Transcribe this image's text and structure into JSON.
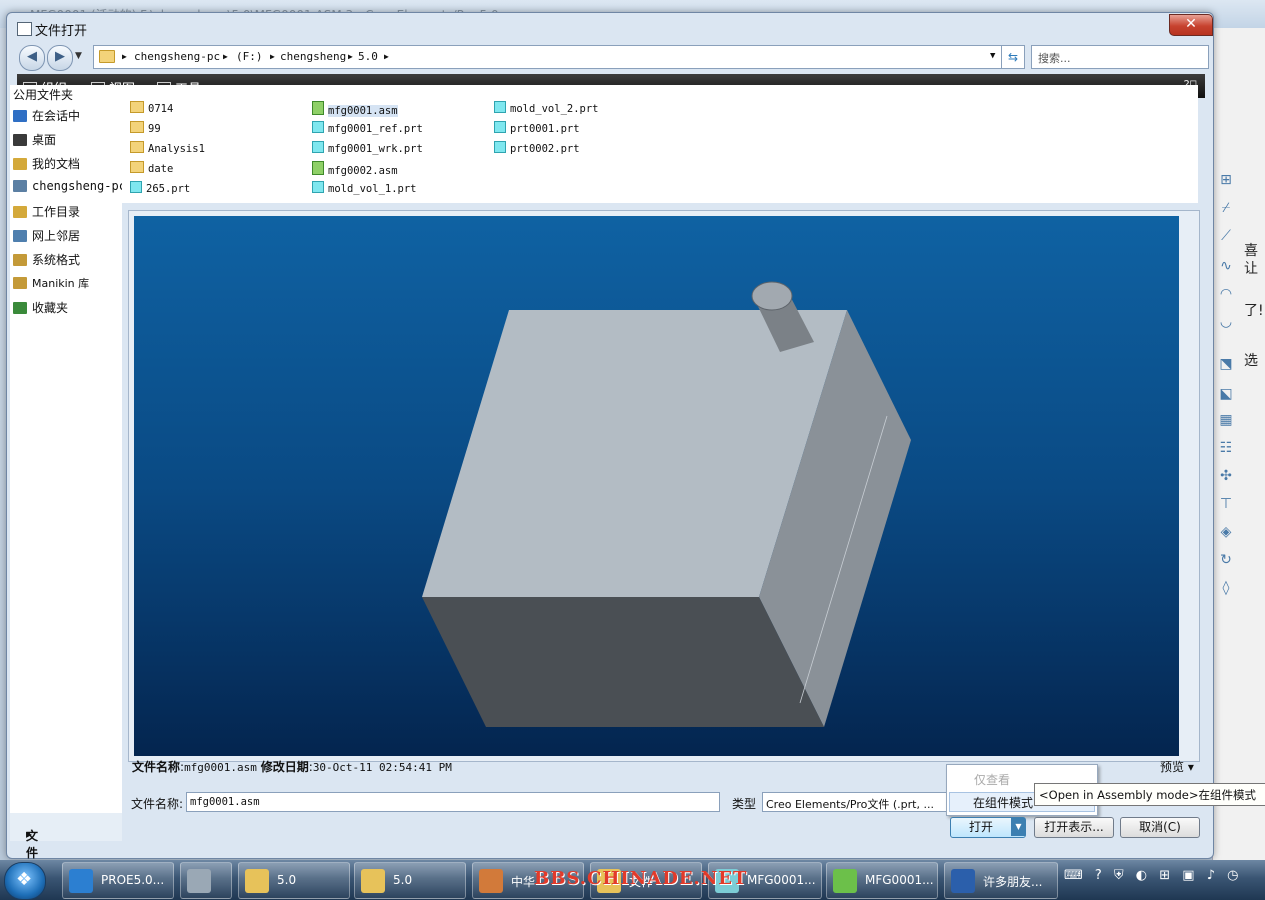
{
  "background_window": {
    "title": "MFG0001 (活动的) F:\\chengsheng\\5.0\\MFG0001.ASM 3 - Creo Elements/Pro 5.0",
    "right_text": [
      "喜",
      "让",
      "了!",
      "选"
    ]
  },
  "dialog": {
    "title": "文件打开",
    "close_label": "✕"
  },
  "address_bar": {
    "crumbs": [
      "chengsheng-pc",
      "(F:)",
      "chengsheng",
      "5.0"
    ],
    "search_placeholder": "搜索..."
  },
  "toolbar": {
    "organize": "组织",
    "view": "视图",
    "tools": "工具"
  },
  "sidebar": {
    "header": "公用文件夹",
    "items": [
      {
        "label": "在会话中",
        "icon": "session-icon",
        "color": "#2f6fc4"
      },
      {
        "label": "桌面",
        "icon": "desktop-icon",
        "color": "#3a3a3a"
      },
      {
        "label": "我的文档",
        "icon": "documents-icon",
        "color": "#d4a93a"
      },
      {
        "label": "chengsheng-pc",
        "icon": "computer-icon",
        "color": "#5b7fa3"
      },
      {
        "label": "工作目录",
        "icon": "work-dir-icon",
        "color": "#d4a93a"
      },
      {
        "label": "网上邻居",
        "icon": "network-icon",
        "color": "#4f7fae"
      },
      {
        "label": "系统格式",
        "icon": "system-format-icon",
        "color": "#c49a38"
      },
      {
        "label": "Manikin 库",
        "icon": "manikin-icon",
        "color": "#c49a38"
      },
      {
        "label": "收藏夹",
        "icon": "favorites-icon",
        "color": "#3a8a3a"
      }
    ],
    "folder_tree": "文件夹树"
  },
  "files": [
    {
      "name": "0714",
      "type": "folder"
    },
    {
      "name": "99",
      "type": "folder"
    },
    {
      "name": "Analysis1",
      "type": "folder"
    },
    {
      "name": "date",
      "type": "folder"
    },
    {
      "name": "265.prt",
      "type": "prt"
    },
    {
      "name": "mfg0001.asm",
      "type": "asm",
      "selected": true
    },
    {
      "name": "mfg0001_ref.prt",
      "type": "prt"
    },
    {
      "name": "mfg0001_wrk.prt",
      "type": "prt"
    },
    {
      "name": "mfg0002.asm",
      "type": "asm"
    },
    {
      "name": "mold_vol_1.prt",
      "type": "prt"
    },
    {
      "name": "mold_vol_2.prt",
      "type": "prt"
    },
    {
      "name": "prt0001.prt",
      "type": "prt"
    },
    {
      "name": "prt0002.prt",
      "type": "prt"
    }
  ],
  "file_info": {
    "name_label": "文件名称",
    "name_value": "mfg0001.asm",
    "date_label": "修改日期",
    "date_value": "30-Oct-11 02:54:41 PM"
  },
  "preview_label": "预览",
  "filename_field": {
    "label": "文件名称:",
    "value": "mfg0001.asm"
  },
  "type_field": {
    "label": "类型",
    "value": "Creo Elements/Pro文件 (.prt, ..."
  },
  "open_menu": {
    "view_only": "仅查看",
    "assembly_mode": "在组件模式"
  },
  "tooltip": "<Open in Assembly mode>在组件模式",
  "buttons": {
    "open": "打开",
    "open_representation": "打开表示...",
    "cancel": "取消(C)"
  },
  "taskbar": {
    "items": [
      {
        "label": "PROE5.0...",
        "color": "#2c7fd1"
      },
      {
        "label": "",
        "color": "#9aa8b5"
      },
      {
        "label": "5.0",
        "color": "#e7c25a"
      },
      {
        "label": "5.0",
        "color": "#e7c25a"
      },
      {
        "label": "中华",
        "color": "#d27a3a"
      },
      {
        "label": "文件",
        "color": "#e7c25a"
      },
      {
        "label": "MFG0001...",
        "color": "#7ccdd6"
      },
      {
        "label": "MFG0001...",
        "color": "#6cc04a"
      },
      {
        "label": "许多朋友...",
        "color": "#2b5fab"
      }
    ],
    "watermark": "BBS.CHINADE.NET"
  }
}
